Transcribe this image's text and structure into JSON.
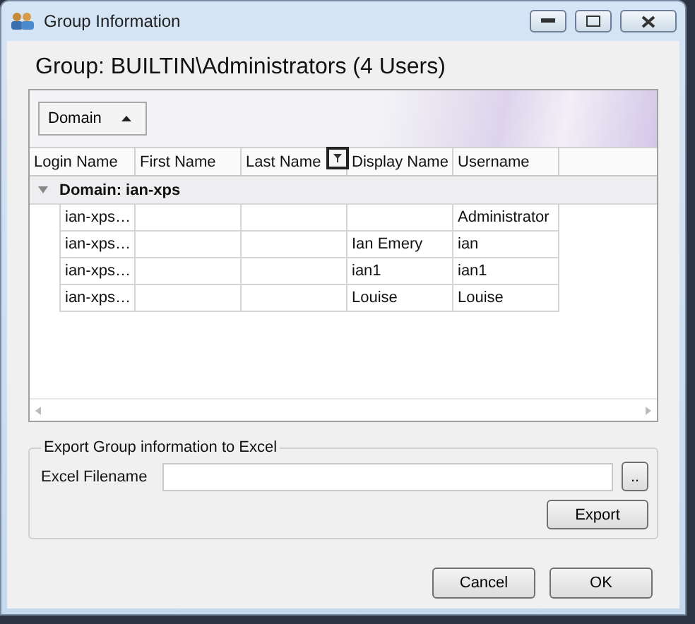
{
  "window": {
    "title": "Group Information"
  },
  "heading": "Group: BUILTIN\\Administrators  (4 Users)",
  "group_by": {
    "label": "Domain"
  },
  "table": {
    "columns": [
      "Login Name",
      "First Name",
      "Last Name",
      "Display Name",
      "Username"
    ],
    "group": {
      "label": "Domain: ian-xps",
      "expanded": true
    },
    "rows": [
      {
        "cells": [
          "ian-xps…",
          "",
          "",
          "",
          "Administrator"
        ]
      },
      {
        "cells": [
          "ian-xps…",
          "",
          "",
          "Ian Emery",
          "ian"
        ]
      },
      {
        "cells": [
          "ian-xps…",
          "",
          "",
          "ian1",
          "ian1"
        ]
      },
      {
        "cells": [
          "ian-xps…",
          "",
          "",
          "Louise",
          "Louise"
        ]
      }
    ]
  },
  "export": {
    "legend": "Export Group information to Excel",
    "field_label": "Excel Filename",
    "browse": "..",
    "button": "Export"
  },
  "buttons": [
    "Cancel",
    "OK"
  ]
}
